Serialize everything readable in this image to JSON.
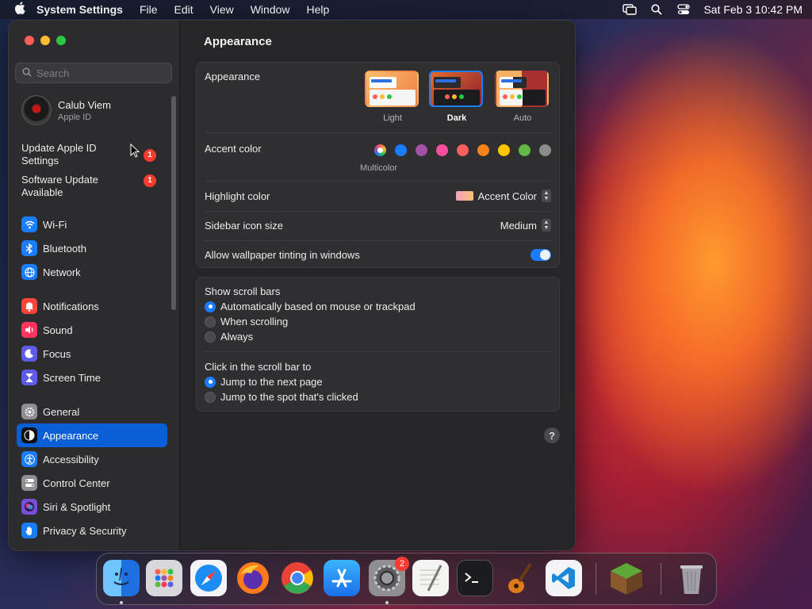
{
  "menubar": {
    "app_name": "System Settings",
    "menus": [
      "File",
      "Edit",
      "View",
      "Window",
      "Help"
    ],
    "datetime": "Sat Feb 3  10:42 PM"
  },
  "sidebar": {
    "search_placeholder": "Search",
    "profile": {
      "name": "Calub Viem",
      "subtitle": "Apple ID"
    },
    "notices": [
      {
        "label": "Update Apple ID Settings",
        "badge": "1"
      },
      {
        "label": "Software Update Available",
        "badge": "1"
      }
    ],
    "groups": [
      [
        {
          "label": "Wi-Fi",
          "icon": "wifi-icon",
          "color": "#1a7cff"
        },
        {
          "label": "Bluetooth",
          "icon": "bluetooth-icon",
          "color": "#1a7cff"
        },
        {
          "label": "Network",
          "icon": "globe-icon",
          "color": "#1a7cff"
        }
      ],
      [
        {
          "label": "Notifications",
          "icon": "bell-icon",
          "color": "#ff453a"
        },
        {
          "label": "Sound",
          "icon": "speaker-icon",
          "color": "#ff375f"
        },
        {
          "label": "Focus",
          "icon": "moon-icon",
          "color": "#5e5ce6"
        },
        {
          "label": "Screen Time",
          "icon": "hourglass-icon",
          "color": "#5e5ce6"
        }
      ],
      [
        {
          "label": "General",
          "icon": "gear-icon",
          "color": "#8e8e93"
        },
        {
          "label": "Appearance",
          "icon": "appearance-icon",
          "color": "#111111",
          "active": true
        },
        {
          "label": "Accessibility",
          "icon": "accessibility-icon",
          "color": "#1a7cff"
        },
        {
          "label": "Control Center",
          "icon": "control-center-icon",
          "color": "#8e8e93"
        },
        {
          "label": "Siri & Spotlight",
          "icon": "siri-icon",
          "color": "#7a4fd8"
        },
        {
          "label": "Privacy & Security",
          "icon": "hand-icon",
          "color": "#1a7cff"
        }
      ]
    ]
  },
  "content": {
    "title": "Appearance",
    "appearance": {
      "label": "Appearance",
      "options": [
        {
          "label": "Light",
          "selected": false
        },
        {
          "label": "Dark",
          "selected": true
        },
        {
          "label": "Auto",
          "selected": false
        }
      ]
    },
    "accent": {
      "label": "Accent color",
      "caption": "Multicolor",
      "colors": [
        "multicolor",
        "#1a7cff",
        "#a550a7",
        "#f74f9e",
        "#fc5f5f",
        "#f7821b",
        "#ffc600",
        "#62ba46",
        "#8c8c8c"
      ]
    },
    "highlight": {
      "label": "Highlight color",
      "value": "Accent Color"
    },
    "icon_size": {
      "label": "Sidebar icon size",
      "value": "Medium"
    },
    "tinting": {
      "label": "Allow wallpaper tinting in windows",
      "on": true
    },
    "scroll_bars": {
      "label": "Show scroll bars",
      "options": [
        {
          "label": "Automatically based on mouse or trackpad",
          "selected": true
        },
        {
          "label": "When scrolling",
          "selected": false
        },
        {
          "label": "Always",
          "selected": false
        }
      ]
    },
    "click_scroll": {
      "label": "Click in the scroll bar to",
      "options": [
        {
          "label": "Jump to the next page",
          "selected": true
        },
        {
          "label": "Jump to the spot that's clicked",
          "selected": false
        }
      ]
    },
    "help_label": "?"
  },
  "dock": {
    "system_settings_badge": "2"
  }
}
